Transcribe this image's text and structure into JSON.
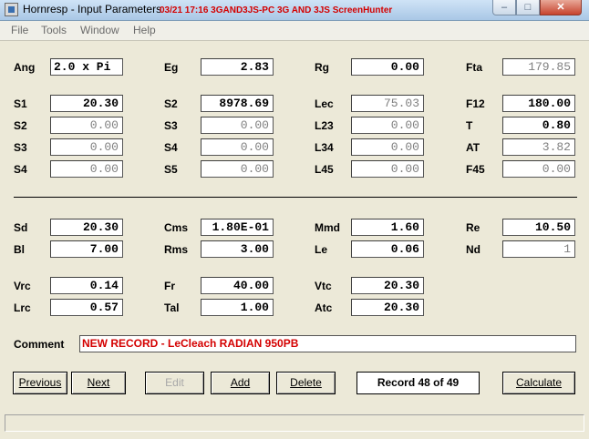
{
  "window": {
    "title": "Hornresp - Input Parameters",
    "overlay": "03/21  17:16  3GAND3JS-PC  3G AND 3JS  ScreenHunter"
  },
  "menu": [
    "File",
    "Tools",
    "Window",
    "Help"
  ],
  "params": {
    "Ang": "2.0 x Pi",
    "Eg": "2.83",
    "Rg": "0.00",
    "Fta": "179.85",
    "S1": "20.30",
    "S2": "8978.69",
    "Lec": "75.03",
    "F12": "180.00",
    "S2b": "0.00",
    "S3": "0.00",
    "L23": "0.00",
    "T": "0.80",
    "S3b": "0.00",
    "S4": "0.00",
    "L34": "0.00",
    "AT": "3.82",
    "S4b": "0.00",
    "S5": "0.00",
    "L45": "0.00",
    "F45": "0.00",
    "Sd": "20.30",
    "Cms": "1.80E-01",
    "Mmd": "1.60",
    "Re": "10.50",
    "Bl": "7.00",
    "Rms": "3.00",
    "Le": "0.06",
    "Nd": "1",
    "Vrc": "0.14",
    "Fr": "40.00",
    "Vtc": "20.30",
    "Lrc": "0.57",
    "Tal": "1.00",
    "Atc": "20.30"
  },
  "labels": {
    "Ang": "Ang",
    "Eg": "Eg",
    "Rg": "Rg",
    "Fta": "Fta",
    "S1": "S1",
    "S2": "S2",
    "Lec": "Lec",
    "F12": "F12",
    "S3": "S3",
    "L23": "L23",
    "T": "T",
    "S4": "S4",
    "L34": "L34",
    "AT": "AT",
    "S5": "S5",
    "L45": "L45",
    "F45": "F45",
    "Sd": "Sd",
    "Cms": "Cms",
    "Mmd": "Mmd",
    "Re": "Re",
    "Bl": "Bl",
    "Rms": "Rms",
    "Le": "Le",
    "Nd": "Nd",
    "Vrc": "Vrc",
    "Fr": "Fr",
    "Vtc": "Vtc",
    "Lrc": "Lrc",
    "Tal": "Tal",
    "Atc": "Atc",
    "Comment": "Comment"
  },
  "comment": "NEW RECORD - LeCleach RADIAN 950PB",
  "buttons": {
    "previous": "Previous",
    "next": "Next",
    "edit": "Edit",
    "add": "Add",
    "delete": "Delete",
    "calculate": "Calculate"
  },
  "record": "Record 48 of 49",
  "colors": {
    "accent_red": "#d40000",
    "readonly_text": "#808080"
  }
}
